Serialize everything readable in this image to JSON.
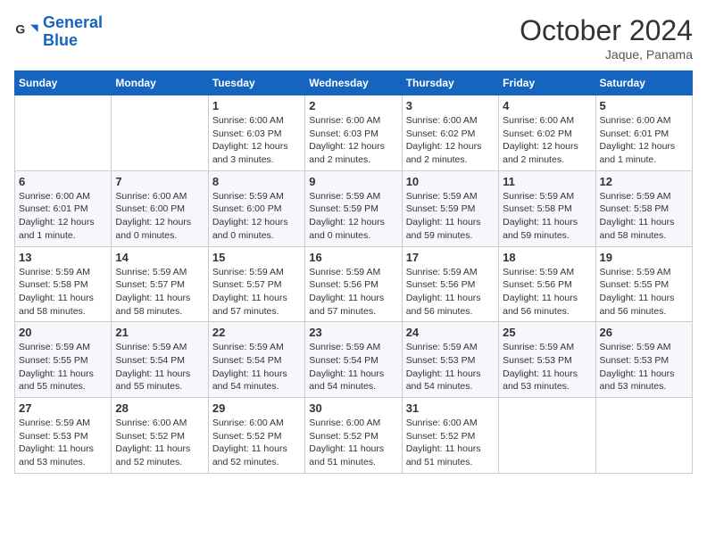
{
  "header": {
    "logo_line1": "General",
    "logo_line2": "Blue",
    "month": "October 2024",
    "location": "Jaque, Panama"
  },
  "days_of_week": [
    "Sunday",
    "Monday",
    "Tuesday",
    "Wednesday",
    "Thursday",
    "Friday",
    "Saturday"
  ],
  "weeks": [
    [
      {
        "day": "",
        "info": ""
      },
      {
        "day": "",
        "info": ""
      },
      {
        "day": "1",
        "info": "Sunrise: 6:00 AM\nSunset: 6:03 PM\nDaylight: 12 hours\nand 3 minutes."
      },
      {
        "day": "2",
        "info": "Sunrise: 6:00 AM\nSunset: 6:03 PM\nDaylight: 12 hours\nand 2 minutes."
      },
      {
        "day": "3",
        "info": "Sunrise: 6:00 AM\nSunset: 6:02 PM\nDaylight: 12 hours\nand 2 minutes."
      },
      {
        "day": "4",
        "info": "Sunrise: 6:00 AM\nSunset: 6:02 PM\nDaylight: 12 hours\nand 2 minutes."
      },
      {
        "day": "5",
        "info": "Sunrise: 6:00 AM\nSunset: 6:01 PM\nDaylight: 12 hours\nand 1 minute."
      }
    ],
    [
      {
        "day": "6",
        "info": "Sunrise: 6:00 AM\nSunset: 6:01 PM\nDaylight: 12 hours\nand 1 minute."
      },
      {
        "day": "7",
        "info": "Sunrise: 6:00 AM\nSunset: 6:00 PM\nDaylight: 12 hours\nand 0 minutes."
      },
      {
        "day": "8",
        "info": "Sunrise: 5:59 AM\nSunset: 6:00 PM\nDaylight: 12 hours\nand 0 minutes."
      },
      {
        "day": "9",
        "info": "Sunrise: 5:59 AM\nSunset: 5:59 PM\nDaylight: 12 hours\nand 0 minutes."
      },
      {
        "day": "10",
        "info": "Sunrise: 5:59 AM\nSunset: 5:59 PM\nDaylight: 11 hours\nand 59 minutes."
      },
      {
        "day": "11",
        "info": "Sunrise: 5:59 AM\nSunset: 5:58 PM\nDaylight: 11 hours\nand 59 minutes."
      },
      {
        "day": "12",
        "info": "Sunrise: 5:59 AM\nSunset: 5:58 PM\nDaylight: 11 hours\nand 58 minutes."
      }
    ],
    [
      {
        "day": "13",
        "info": "Sunrise: 5:59 AM\nSunset: 5:58 PM\nDaylight: 11 hours\nand 58 minutes."
      },
      {
        "day": "14",
        "info": "Sunrise: 5:59 AM\nSunset: 5:57 PM\nDaylight: 11 hours\nand 58 minutes."
      },
      {
        "day": "15",
        "info": "Sunrise: 5:59 AM\nSunset: 5:57 PM\nDaylight: 11 hours\nand 57 minutes."
      },
      {
        "day": "16",
        "info": "Sunrise: 5:59 AM\nSunset: 5:56 PM\nDaylight: 11 hours\nand 57 minutes."
      },
      {
        "day": "17",
        "info": "Sunrise: 5:59 AM\nSunset: 5:56 PM\nDaylight: 11 hours\nand 56 minutes."
      },
      {
        "day": "18",
        "info": "Sunrise: 5:59 AM\nSunset: 5:56 PM\nDaylight: 11 hours\nand 56 minutes."
      },
      {
        "day": "19",
        "info": "Sunrise: 5:59 AM\nSunset: 5:55 PM\nDaylight: 11 hours\nand 56 minutes."
      }
    ],
    [
      {
        "day": "20",
        "info": "Sunrise: 5:59 AM\nSunset: 5:55 PM\nDaylight: 11 hours\nand 55 minutes."
      },
      {
        "day": "21",
        "info": "Sunrise: 5:59 AM\nSunset: 5:54 PM\nDaylight: 11 hours\nand 55 minutes."
      },
      {
        "day": "22",
        "info": "Sunrise: 5:59 AM\nSunset: 5:54 PM\nDaylight: 11 hours\nand 54 minutes."
      },
      {
        "day": "23",
        "info": "Sunrise: 5:59 AM\nSunset: 5:54 PM\nDaylight: 11 hours\nand 54 minutes."
      },
      {
        "day": "24",
        "info": "Sunrise: 5:59 AM\nSunset: 5:53 PM\nDaylight: 11 hours\nand 54 minutes."
      },
      {
        "day": "25",
        "info": "Sunrise: 5:59 AM\nSunset: 5:53 PM\nDaylight: 11 hours\nand 53 minutes."
      },
      {
        "day": "26",
        "info": "Sunrise: 5:59 AM\nSunset: 5:53 PM\nDaylight: 11 hours\nand 53 minutes."
      }
    ],
    [
      {
        "day": "27",
        "info": "Sunrise: 5:59 AM\nSunset: 5:53 PM\nDaylight: 11 hours\nand 53 minutes."
      },
      {
        "day": "28",
        "info": "Sunrise: 6:00 AM\nSunset: 5:52 PM\nDaylight: 11 hours\nand 52 minutes."
      },
      {
        "day": "29",
        "info": "Sunrise: 6:00 AM\nSunset: 5:52 PM\nDaylight: 11 hours\nand 52 minutes."
      },
      {
        "day": "30",
        "info": "Sunrise: 6:00 AM\nSunset: 5:52 PM\nDaylight: 11 hours\nand 51 minutes."
      },
      {
        "day": "31",
        "info": "Sunrise: 6:00 AM\nSunset: 5:52 PM\nDaylight: 11 hours\nand 51 minutes."
      },
      {
        "day": "",
        "info": ""
      },
      {
        "day": "",
        "info": ""
      }
    ]
  ]
}
